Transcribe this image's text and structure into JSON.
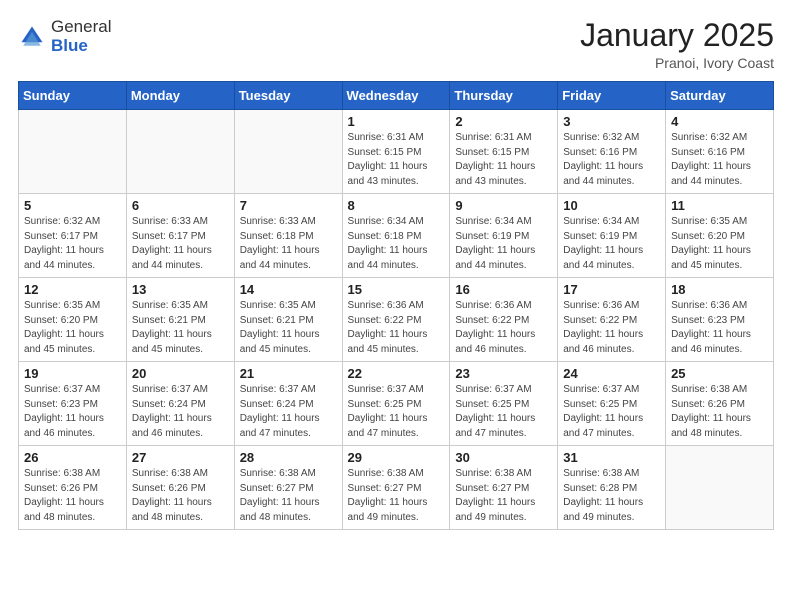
{
  "logo": {
    "general": "General",
    "blue": "Blue"
  },
  "header": {
    "month_year": "January 2025",
    "location": "Pranoi, Ivory Coast"
  },
  "days_of_week": [
    "Sunday",
    "Monday",
    "Tuesday",
    "Wednesday",
    "Thursday",
    "Friday",
    "Saturday"
  ],
  "weeks": [
    [
      {
        "day": "",
        "info": ""
      },
      {
        "day": "",
        "info": ""
      },
      {
        "day": "",
        "info": ""
      },
      {
        "day": "1",
        "info": "Sunrise: 6:31 AM\nSunset: 6:15 PM\nDaylight: 11 hours\nand 43 minutes."
      },
      {
        "day": "2",
        "info": "Sunrise: 6:31 AM\nSunset: 6:15 PM\nDaylight: 11 hours\nand 43 minutes."
      },
      {
        "day": "3",
        "info": "Sunrise: 6:32 AM\nSunset: 6:16 PM\nDaylight: 11 hours\nand 44 minutes."
      },
      {
        "day": "4",
        "info": "Sunrise: 6:32 AM\nSunset: 6:16 PM\nDaylight: 11 hours\nand 44 minutes."
      }
    ],
    [
      {
        "day": "5",
        "info": "Sunrise: 6:32 AM\nSunset: 6:17 PM\nDaylight: 11 hours\nand 44 minutes."
      },
      {
        "day": "6",
        "info": "Sunrise: 6:33 AM\nSunset: 6:17 PM\nDaylight: 11 hours\nand 44 minutes."
      },
      {
        "day": "7",
        "info": "Sunrise: 6:33 AM\nSunset: 6:18 PM\nDaylight: 11 hours\nand 44 minutes."
      },
      {
        "day": "8",
        "info": "Sunrise: 6:34 AM\nSunset: 6:18 PM\nDaylight: 11 hours\nand 44 minutes."
      },
      {
        "day": "9",
        "info": "Sunrise: 6:34 AM\nSunset: 6:19 PM\nDaylight: 11 hours\nand 44 minutes."
      },
      {
        "day": "10",
        "info": "Sunrise: 6:34 AM\nSunset: 6:19 PM\nDaylight: 11 hours\nand 44 minutes."
      },
      {
        "day": "11",
        "info": "Sunrise: 6:35 AM\nSunset: 6:20 PM\nDaylight: 11 hours\nand 45 minutes."
      }
    ],
    [
      {
        "day": "12",
        "info": "Sunrise: 6:35 AM\nSunset: 6:20 PM\nDaylight: 11 hours\nand 45 minutes."
      },
      {
        "day": "13",
        "info": "Sunrise: 6:35 AM\nSunset: 6:21 PM\nDaylight: 11 hours\nand 45 minutes."
      },
      {
        "day": "14",
        "info": "Sunrise: 6:35 AM\nSunset: 6:21 PM\nDaylight: 11 hours\nand 45 minutes."
      },
      {
        "day": "15",
        "info": "Sunrise: 6:36 AM\nSunset: 6:22 PM\nDaylight: 11 hours\nand 45 minutes."
      },
      {
        "day": "16",
        "info": "Sunrise: 6:36 AM\nSunset: 6:22 PM\nDaylight: 11 hours\nand 46 minutes."
      },
      {
        "day": "17",
        "info": "Sunrise: 6:36 AM\nSunset: 6:22 PM\nDaylight: 11 hours\nand 46 minutes."
      },
      {
        "day": "18",
        "info": "Sunrise: 6:36 AM\nSunset: 6:23 PM\nDaylight: 11 hours\nand 46 minutes."
      }
    ],
    [
      {
        "day": "19",
        "info": "Sunrise: 6:37 AM\nSunset: 6:23 PM\nDaylight: 11 hours\nand 46 minutes."
      },
      {
        "day": "20",
        "info": "Sunrise: 6:37 AM\nSunset: 6:24 PM\nDaylight: 11 hours\nand 46 minutes."
      },
      {
        "day": "21",
        "info": "Sunrise: 6:37 AM\nSunset: 6:24 PM\nDaylight: 11 hours\nand 47 minutes."
      },
      {
        "day": "22",
        "info": "Sunrise: 6:37 AM\nSunset: 6:25 PM\nDaylight: 11 hours\nand 47 minutes."
      },
      {
        "day": "23",
        "info": "Sunrise: 6:37 AM\nSunset: 6:25 PM\nDaylight: 11 hours\nand 47 minutes."
      },
      {
        "day": "24",
        "info": "Sunrise: 6:37 AM\nSunset: 6:25 PM\nDaylight: 11 hours\nand 47 minutes."
      },
      {
        "day": "25",
        "info": "Sunrise: 6:38 AM\nSunset: 6:26 PM\nDaylight: 11 hours\nand 48 minutes."
      }
    ],
    [
      {
        "day": "26",
        "info": "Sunrise: 6:38 AM\nSunset: 6:26 PM\nDaylight: 11 hours\nand 48 minutes."
      },
      {
        "day": "27",
        "info": "Sunrise: 6:38 AM\nSunset: 6:26 PM\nDaylight: 11 hours\nand 48 minutes."
      },
      {
        "day": "28",
        "info": "Sunrise: 6:38 AM\nSunset: 6:27 PM\nDaylight: 11 hours\nand 48 minutes."
      },
      {
        "day": "29",
        "info": "Sunrise: 6:38 AM\nSunset: 6:27 PM\nDaylight: 11 hours\nand 49 minutes."
      },
      {
        "day": "30",
        "info": "Sunrise: 6:38 AM\nSunset: 6:27 PM\nDaylight: 11 hours\nand 49 minutes."
      },
      {
        "day": "31",
        "info": "Sunrise: 6:38 AM\nSunset: 6:28 PM\nDaylight: 11 hours\nand 49 minutes."
      },
      {
        "day": "",
        "info": ""
      }
    ]
  ]
}
